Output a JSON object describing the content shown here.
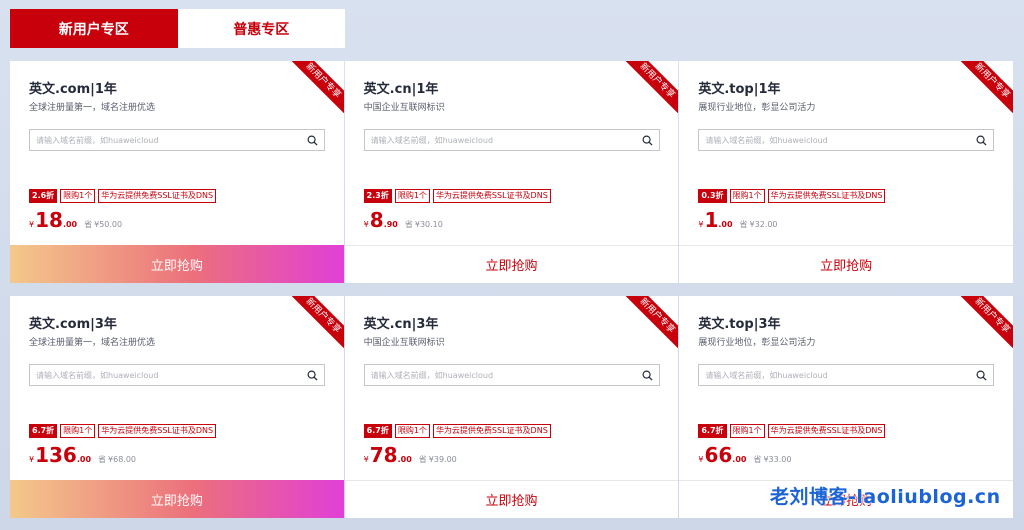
{
  "tabs": [
    {
      "label": "新用户专区",
      "active": true
    },
    {
      "label": "普惠专区",
      "active": false
    }
  ],
  "search_placeholder": "请输入域名前缀，如huaweicloud",
  "ribbon_label": "新用户专享",
  "tag_limit": "限购1个",
  "tag_ssl": "华为云提供免费SSL证书及DNS",
  "currency": "¥",
  "saved_prefix": "省",
  "buy_label": "立即抢购",
  "cards": [
    {
      "title": "英文.com|1年",
      "desc": "全球注册量第一，域名注册优选",
      "discount": "2.6折",
      "price_int": "18",
      "price_dec": ".00",
      "orig": "¥50.00",
      "buy_style": "gradient"
    },
    {
      "title": "英文.cn|1年",
      "desc": "中国企业互联网标识",
      "discount": "2.3折",
      "price_int": "8",
      "price_dec": ".90",
      "orig": "¥30.10",
      "buy_style": "plain"
    },
    {
      "title": "英文.top|1年",
      "desc": "展现行业地位，彰显公司活力",
      "discount": "0.3折",
      "price_int": "1",
      "price_dec": ".00",
      "orig": "¥32.00",
      "buy_style": "plain"
    },
    {
      "title": "英文.com|3年",
      "desc": "全球注册量第一，域名注册优选",
      "discount": "6.7折",
      "price_int": "136",
      "price_dec": ".00",
      "orig": "¥68.00",
      "buy_style": "gradient"
    },
    {
      "title": "英文.cn|3年",
      "desc": "中国企业互联网标识",
      "discount": "6.7折",
      "price_int": "78",
      "price_dec": ".00",
      "orig": "¥39.00",
      "buy_style": "plain"
    },
    {
      "title": "英文.top|3年",
      "desc": "展现行业地位，彰显公司活力",
      "discount": "6.7折",
      "price_int": "66",
      "price_dec": ".00",
      "orig": "¥33.00",
      "buy_style": "plain"
    }
  ],
  "watermark": "老刘博客-laoliublog.cn",
  "colors": {
    "accent": "#c7000b",
    "gradient_start": "#f3c98a",
    "gradient_end": "#e13fd6"
  }
}
